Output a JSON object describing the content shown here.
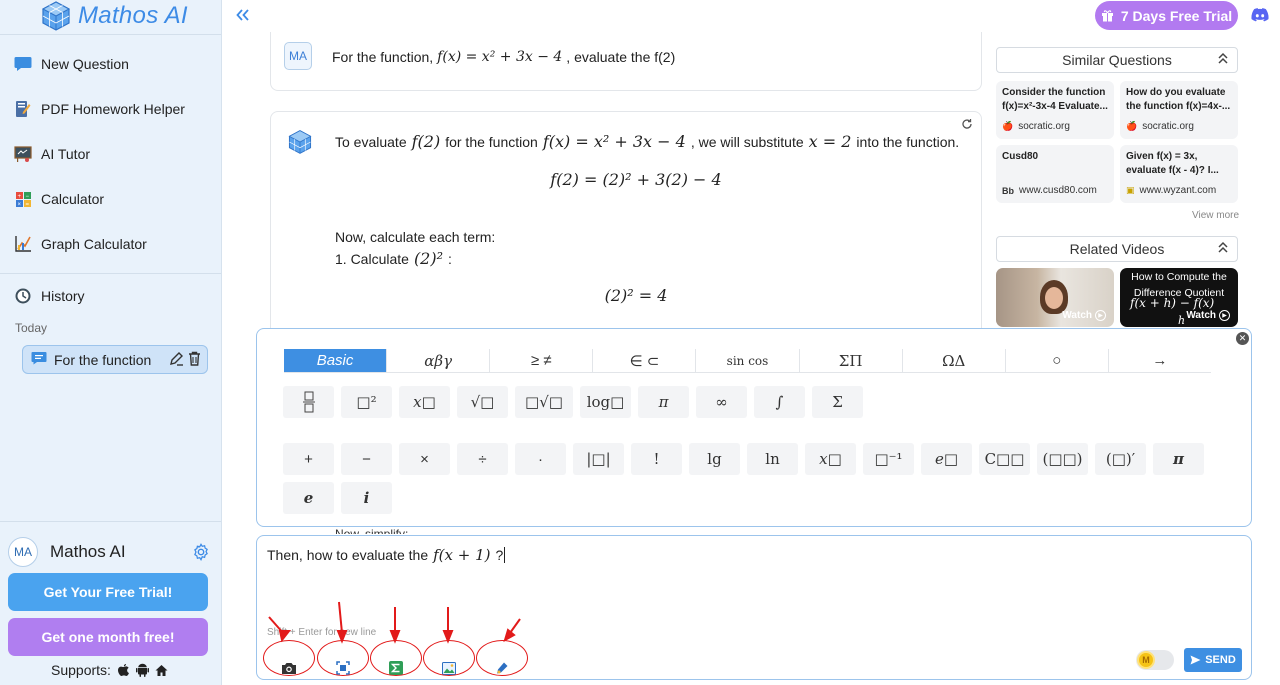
{
  "app": {
    "name": "Mathos AI",
    "trial_pill": "7 Days Free Trial"
  },
  "sidebar": {
    "items": [
      {
        "label": "New Question",
        "icon": "chat-bubble-icon"
      },
      {
        "label": "PDF Homework Helper",
        "icon": "notebook-pen-icon"
      },
      {
        "label": "AI Tutor",
        "icon": "blackboard-icon"
      },
      {
        "label": "Calculator",
        "icon": "calculator-icon"
      },
      {
        "label": "Graph Calculator",
        "icon": "graph-icon"
      }
    ],
    "history_label": "History",
    "today_label": "Today",
    "history_item": "For the function",
    "user_initials": "MA",
    "user_name": "Mathos AI",
    "btn_trial": "Get Your Free Trial!",
    "btn_month": "Get one month free!",
    "supports_label": "Supports:"
  },
  "chat": {
    "question": {
      "avatar": "MA",
      "prefix": "For the function,",
      "math": "f(x) = x² + 3x − 4",
      "suffix": ", evaluate the f(2)"
    },
    "answer": {
      "line1_a": "To evaluate",
      "line1_m1": "f(2)",
      "line1_b": "for the function",
      "line1_m2": "f(x) = x² + 3x − 4",
      "line1_c": ", we will substitute",
      "line1_m3": "x = 2",
      "line1_d": "into the function.",
      "eq1": "f(2) = (2)² + 3(2) − 4",
      "line2": "Now, calculate each term:",
      "line3_a": "1. Calculate",
      "line3_m": "(2)²",
      "line3_b": ":",
      "eq2": "(2)² = 4"
    },
    "peek_text": "Now, simplify:"
  },
  "right_panel": {
    "similar_title": "Similar Questions",
    "similar": [
      {
        "title": "Consider the function f(x)=x²-3x-4 Evaluate...",
        "source": "socratic.org",
        "fav": "🍎"
      },
      {
        "title": "How do you evaluate the function f(x)=4x-...",
        "source": "socratic.org",
        "fav": "🍎"
      },
      {
        "title": "Cusd80",
        "source": "www.cusd80.com",
        "fav": "Bb"
      },
      {
        "title": "Given f(x) = 3x, evaluate f(x - 4)? I...",
        "source": "www.wyzant.com",
        "fav": "▣"
      }
    ],
    "view_more": "View more",
    "videos_title": "Related Videos",
    "video_watch": "Watch",
    "video2_title": "How to Compute the Difference Quotient",
    "video2_math": "f(x + h) − f(x)",
    "video2_denom": "h"
  },
  "keyboard": {
    "tabs": [
      "Basic",
      "αβγ",
      "≥ ≠",
      "∈ ⊂",
      "sin cos",
      "ΣΠ",
      "ΩΔ",
      "○",
      "→"
    ],
    "row1": [
      "fraction",
      "□²",
      "x□",
      "√□",
      "□√□",
      "log□",
      "π",
      "∞",
      "∫",
      "Σ"
    ],
    "row2": [
      "+",
      "−",
      "×",
      "÷",
      "·",
      "|□|",
      "!",
      "lg",
      "ln",
      "x□",
      "□⁻¹",
      "e□",
      "C□□",
      "(□□)",
      "(□)′",
      "π"
    ],
    "row3": [
      "e",
      "i"
    ]
  },
  "input": {
    "text_prefix": "Then, how to evaluate the",
    "text_math": "f(x + 1)",
    "text_suffix": "?",
    "hint": "Shift + Enter for new line",
    "send_label": "SEND",
    "coin_label": "M",
    "tools": [
      "camera-icon",
      "scan-icon",
      "sigma-icon",
      "image-icon",
      "pen-icon"
    ]
  },
  "colors": {
    "accent": "#3e8fe2",
    "purple": "#b07ef0",
    "annotation": "#e21a1a"
  }
}
